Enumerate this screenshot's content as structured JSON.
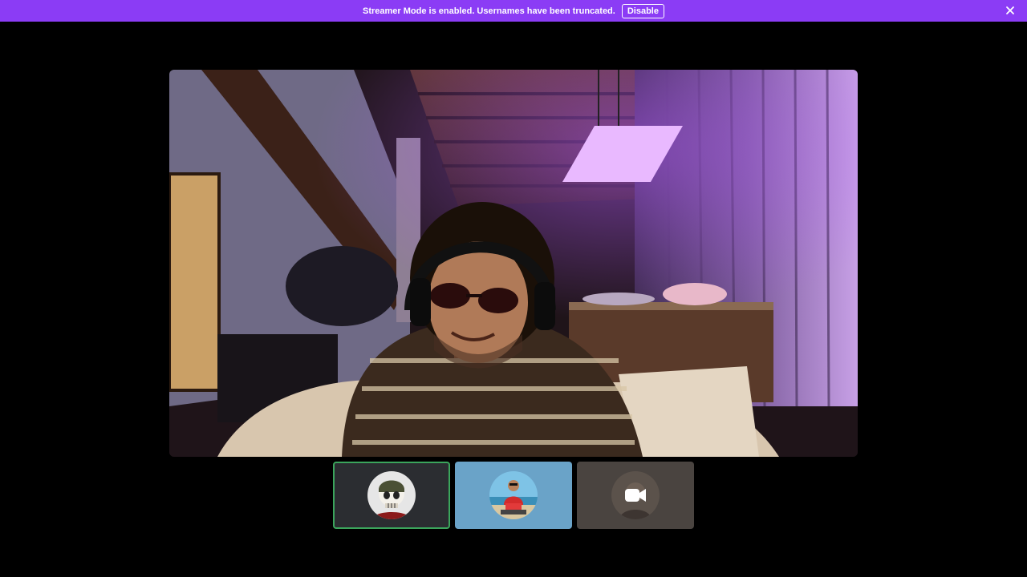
{
  "banner": {
    "message": "Streamer Mode is enabled. Usernames have been truncated.",
    "disable_label": "Disable",
    "close_icon": "close-icon",
    "color": "#8b3cf5"
  },
  "main_video": {
    "stream": "webcam-stream"
  },
  "participants": [
    {
      "avatar": "skull-soldier-avatar",
      "speaking": true,
      "background": "#2b2d31"
    },
    {
      "avatar": "man-red-shirt-avatar",
      "speaking": false,
      "background": "#6aa3c8"
    },
    {
      "avatar": "video-camera-icon",
      "speaking": false,
      "background": "#4a4440"
    }
  ],
  "colors": {
    "speaking_ring": "#3ba55c",
    "background": "#000000"
  }
}
